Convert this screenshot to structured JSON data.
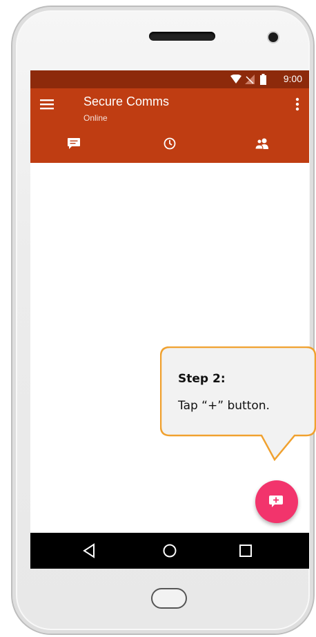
{
  "status_bar": {
    "time": "9:00",
    "icons": [
      "wifi-icon",
      "no-signal-icon",
      "battery-icon"
    ]
  },
  "app_bar": {
    "title": "Secure Comms",
    "subtitle": "Online",
    "menu_icon": "hamburger-menu-icon",
    "overflow_icon": "more-vert-icon"
  },
  "tabs": [
    {
      "icon": "chat-icon",
      "selected": true
    },
    {
      "icon": "clock-icon",
      "selected": false
    },
    {
      "icon": "contacts-icon",
      "selected": false
    }
  ],
  "fab": {
    "icon": "new-message-plus-icon"
  },
  "nav_bar": {
    "icons": [
      "back-triangle-icon",
      "home-circle-icon",
      "recents-square-icon"
    ]
  },
  "callout": {
    "title": "Step 2:",
    "text": "Tap “+” button."
  },
  "colors": {
    "status_bar": "#8d2a0b",
    "app_bar": "#bf3d12",
    "fab": "#f2346c",
    "callout_border": "#f0a12f",
    "callout_fill": "#f2f2f2"
  }
}
